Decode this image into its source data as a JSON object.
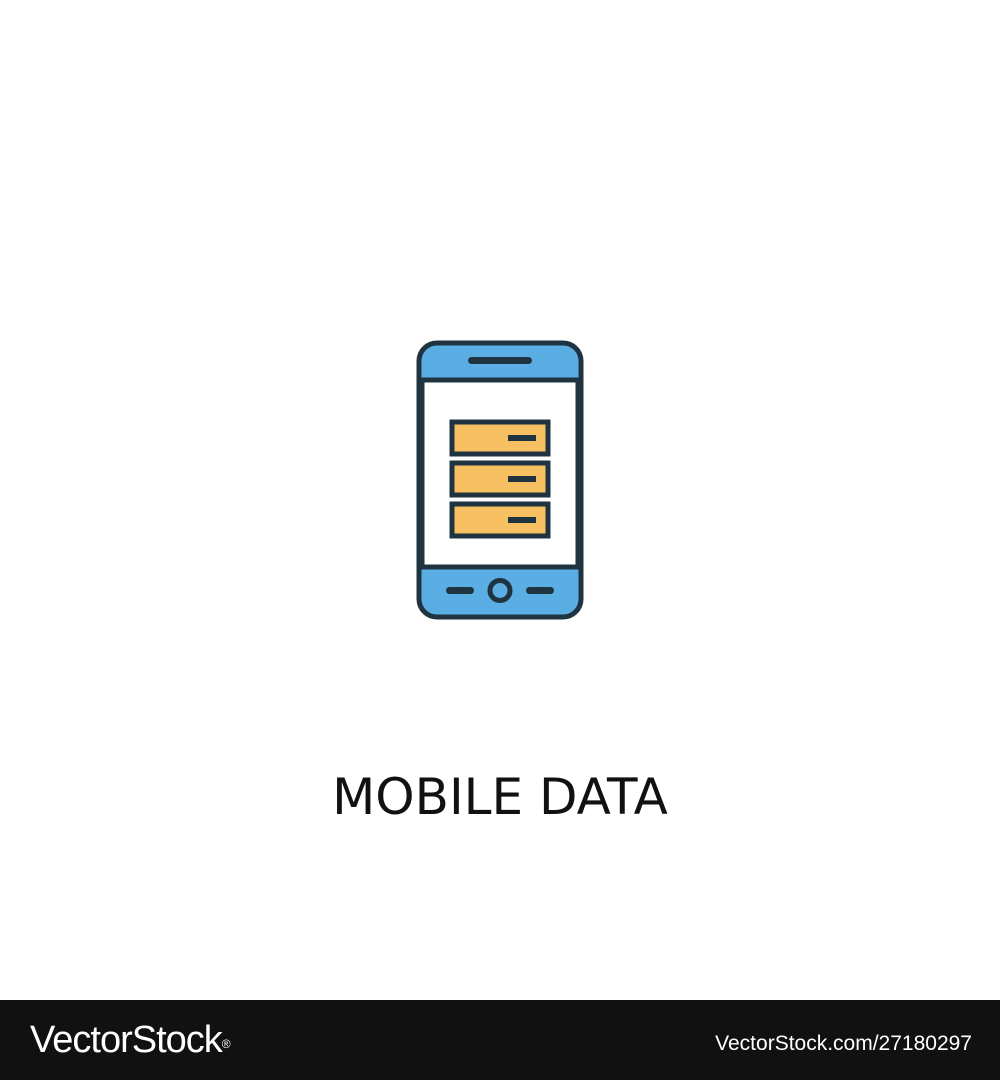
{
  "caption": "MOBILE DATA",
  "icon": {
    "name": "mobile-data-icon",
    "colors": {
      "outline": "#1f3340",
      "phone_body": "#5aaee3",
      "screen": "#ffffff",
      "server_fill": "#f7c062"
    }
  },
  "footer": {
    "brand": "VectorStock",
    "trademark": "®",
    "image_id": "VectorStock.com/27180297",
    "background": "#111111"
  }
}
